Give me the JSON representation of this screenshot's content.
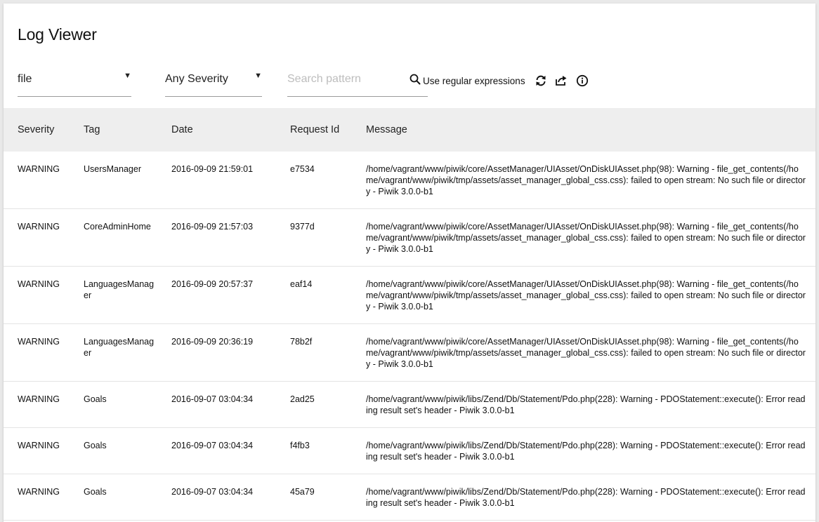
{
  "page": {
    "title": "Log Viewer"
  },
  "filters": {
    "file_value": "file",
    "severity_value": "Any Severity",
    "search_placeholder": "Search pattern",
    "regex_label": "Use regular expressions"
  },
  "icons": {
    "search": "search-icon",
    "refresh": "refresh-icon",
    "export": "export-icon",
    "info": "info-icon"
  },
  "table": {
    "headers": [
      "Severity",
      "Tag",
      "Date",
      "Request Id",
      "Message"
    ],
    "rows": [
      {
        "severity": "WARNING",
        "tag": "UsersManager",
        "date": "2016-09-09 21:59:01",
        "request_id": "e7534",
        "message": "/home/vagrant/www/piwik/core/AssetManager/UIAsset/OnDiskUIAsset.php(98): Warning - file_get_contents(/home/vagrant/www/piwik/tmp/assets/asset_manager_global_css.css): failed to open stream: No such file or directory - Piwik 3.0.0-b1"
      },
      {
        "severity": "WARNING",
        "tag": "CoreAdminHome",
        "date": "2016-09-09 21:57:03",
        "request_id": "9377d",
        "message": "/home/vagrant/www/piwik/core/AssetManager/UIAsset/OnDiskUIAsset.php(98): Warning - file_get_contents(/home/vagrant/www/piwik/tmp/assets/asset_manager_global_css.css): failed to open stream: No such file or directory - Piwik 3.0.0-b1"
      },
      {
        "severity": "WARNING",
        "tag": "LanguagesManager",
        "date": "2016-09-09 20:57:37",
        "request_id": "eaf14",
        "message": "/home/vagrant/www/piwik/core/AssetManager/UIAsset/OnDiskUIAsset.php(98): Warning - file_get_contents(/home/vagrant/www/piwik/tmp/assets/asset_manager_global_css.css): failed to open stream: No such file or directory - Piwik 3.0.0-b1"
      },
      {
        "severity": "WARNING",
        "tag": "LanguagesManager",
        "date": "2016-09-09 20:36:19",
        "request_id": "78b2f",
        "message": "/home/vagrant/www/piwik/core/AssetManager/UIAsset/OnDiskUIAsset.php(98): Warning - file_get_contents(/home/vagrant/www/piwik/tmp/assets/asset_manager_global_css.css): failed to open stream: No such file or directory - Piwik 3.0.0-b1"
      },
      {
        "severity": "WARNING",
        "tag": "Goals",
        "date": "2016-09-07 03:04:34",
        "request_id": "2ad25",
        "message": "/home/vagrant/www/piwik/libs/Zend/Db/Statement/Pdo.php(228): Warning - PDOStatement::execute(): Error reading result set's header - Piwik 3.0.0-b1"
      },
      {
        "severity": "WARNING",
        "tag": "Goals",
        "date": "2016-09-07 03:04:34",
        "request_id": "f4fb3",
        "message": "/home/vagrant/www/piwik/libs/Zend/Db/Statement/Pdo.php(228): Warning - PDOStatement::execute(): Error reading result set's header - Piwik 3.0.0-b1"
      },
      {
        "severity": "WARNING",
        "tag": "Goals",
        "date": "2016-09-07 03:04:34",
        "request_id": "45a79",
        "message": "/home/vagrant/www/piwik/libs/Zend/Db/Statement/Pdo.php(228): Warning - PDOStatement::execute(): Error reading result set's header - Piwik 3.0.0-b1"
      },
      {
        "severity": "",
        "tag": "",
        "date": "",
        "request_id": "",
        "message": ""
      }
    ]
  }
}
